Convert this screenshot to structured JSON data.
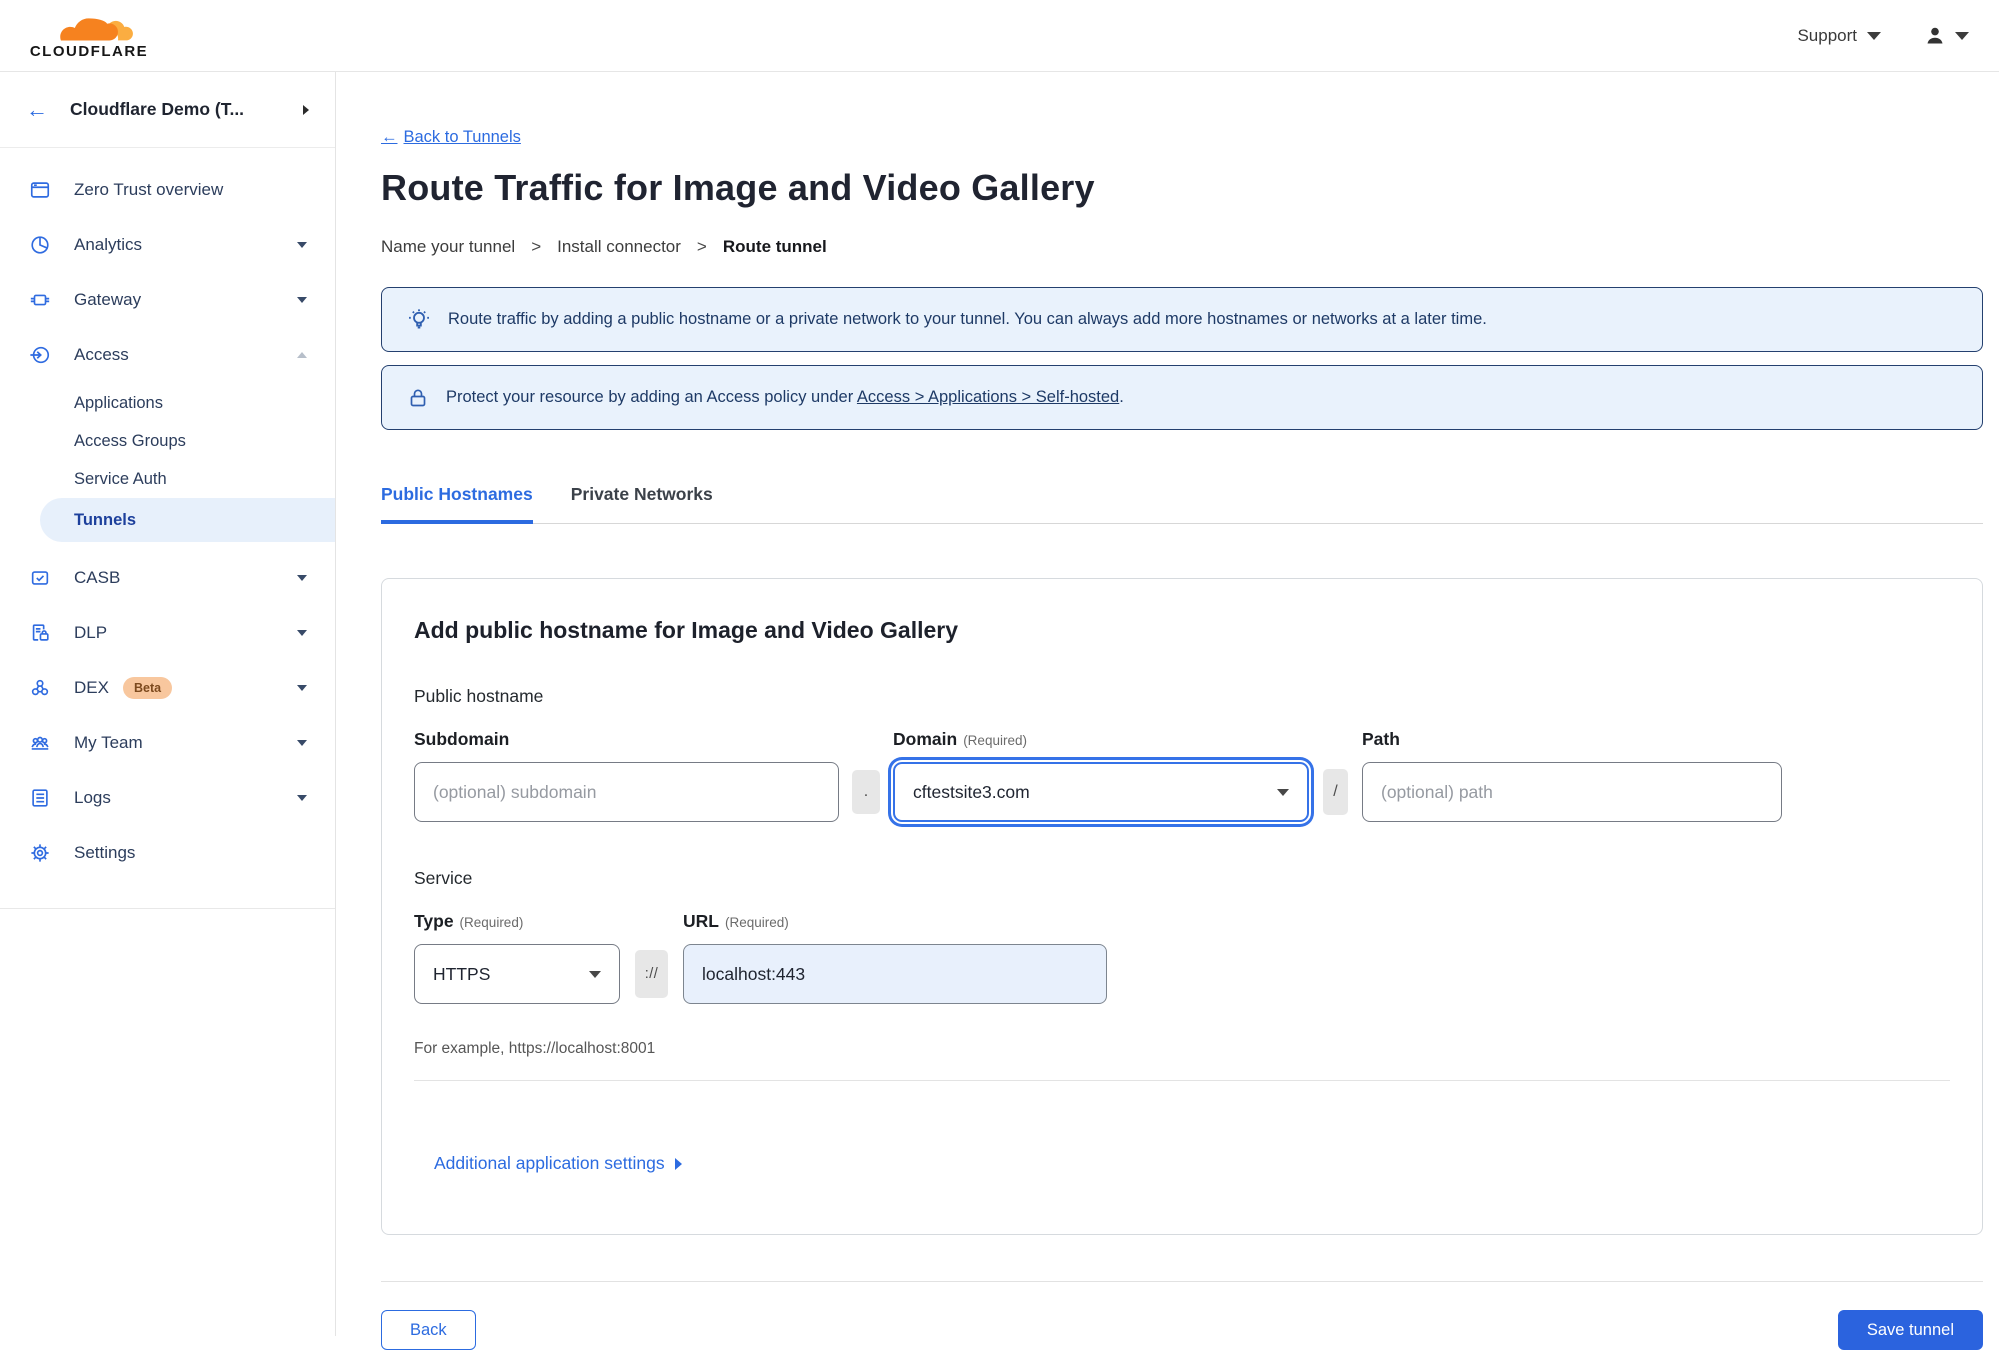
{
  "icons": {
    "back_arrow": "←"
  },
  "topbar": {
    "support_label": "Support"
  },
  "sidebar": {
    "account_label": "Cloudflare Demo (T...",
    "items": [
      {
        "label": "Zero Trust overview"
      },
      {
        "label": "Analytics"
      },
      {
        "label": "Gateway"
      },
      {
        "label": "Access"
      },
      {
        "label": "CASB"
      },
      {
        "label": "DLP"
      },
      {
        "label": "DEX"
      },
      {
        "label": "My Team"
      },
      {
        "label": "Logs"
      },
      {
        "label": "Settings"
      }
    ],
    "dex_badge": "Beta",
    "access_children": [
      {
        "label": "Applications"
      },
      {
        "label": "Access Groups"
      },
      {
        "label": "Service Auth"
      },
      {
        "label": "Tunnels"
      }
    ]
  },
  "header": {
    "back_link": "Back to Tunnels",
    "title": "Route Traffic for Image and Video Gallery",
    "steps": [
      "Name your tunnel",
      "Install connector",
      "Route tunnel"
    ],
    "step_separator": ">"
  },
  "banners": [
    {
      "icon": "lightbulb",
      "text": "Route traffic by adding a public hostname or a private network to your tunnel. You can always add more hostnames or networks at a later time."
    },
    {
      "icon": "lock",
      "text_before": "Protect your resource by adding an Access policy under",
      "link": "Access > Applications > Self-hosted",
      "text_after": "."
    }
  ],
  "tabs": [
    {
      "label": "Public Hostnames",
      "active": true
    },
    {
      "label": "Private Networks",
      "active": false
    }
  ],
  "form": {
    "heading": "Add public hostname for Image and Video Gallery",
    "public_hostname_label": "Public hostname",
    "required_tag": "(Required)",
    "subdomain": {
      "label": "Subdomain",
      "placeholder": "(optional) subdomain",
      "value": ""
    },
    "domain": {
      "label": "Domain",
      "value": "cftestsite3.com"
    },
    "path": {
      "label": "Path",
      "placeholder": "(optional) path",
      "value": ""
    },
    "separators": {
      "dot": ".",
      "slash": "/",
      "scheme": "://"
    },
    "service": {
      "label": "Service",
      "type_label": "Type",
      "type_value": "HTTPS",
      "url_label": "URL",
      "url_value": "localhost:443",
      "example": "For example, https://localhost:8001"
    },
    "additional_settings_label": "Additional application settings"
  },
  "buttons": {
    "back": "Back",
    "save": "Save tunnel"
  },
  "colors": {
    "accent": "#2c6be0",
    "button": "#2b63de",
    "banner_bg": "#e9f2fc",
    "banner_border": "#24406f",
    "active_pill_bg": "#e7f0fb",
    "active_pill_text": "#1d409c"
  }
}
